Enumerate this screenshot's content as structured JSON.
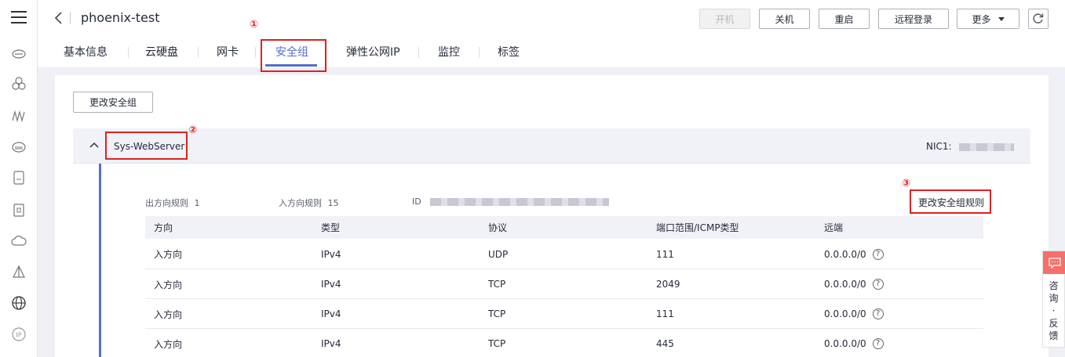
{
  "header": {
    "title": "phoenix-test",
    "buttons": {
      "power_on": "开机",
      "power_off": "关机",
      "restart": "重启",
      "remote_login": "远程登录",
      "more": "更多"
    }
  },
  "tabs": [
    "基本信息",
    "云硬盘",
    "网卡",
    "安全组",
    "弹性公网IP",
    "监控",
    "标签"
  ],
  "active_tab": "安全组",
  "annotations": [
    "①",
    "②",
    "③"
  ],
  "content": {
    "change_sg_button": "更改安全组",
    "security_group": {
      "name": "Sys-WebServer",
      "nic_label": "NIC1:",
      "outbound_label": "出方向规则",
      "outbound_count": "1",
      "inbound_label": "入方向规则",
      "inbound_count": "15",
      "id_label": "ID",
      "change_rules_link": "更改安全组规则"
    },
    "table": {
      "headers": [
        "方向",
        "类型",
        "协议",
        "端口范围/ICMP类型",
        "远端"
      ],
      "rows": [
        [
          "入方向",
          "IPv4",
          "UDP",
          "111",
          "0.0.0.0/0"
        ],
        [
          "入方向",
          "IPv4",
          "TCP",
          "2049",
          "0.0.0.0/0"
        ],
        [
          "入方向",
          "IPv4",
          "TCP",
          "111",
          "0.0.0.0/0"
        ],
        [
          "入方向",
          "IPv4",
          "TCP",
          "445",
          "0.0.0.0/0"
        ]
      ]
    }
  },
  "widget": {
    "consult_text": "咨询·反馈"
  },
  "colors": {
    "accent": "#526ecc",
    "annotation": "#e02020",
    "widget": "#f66f6a"
  }
}
